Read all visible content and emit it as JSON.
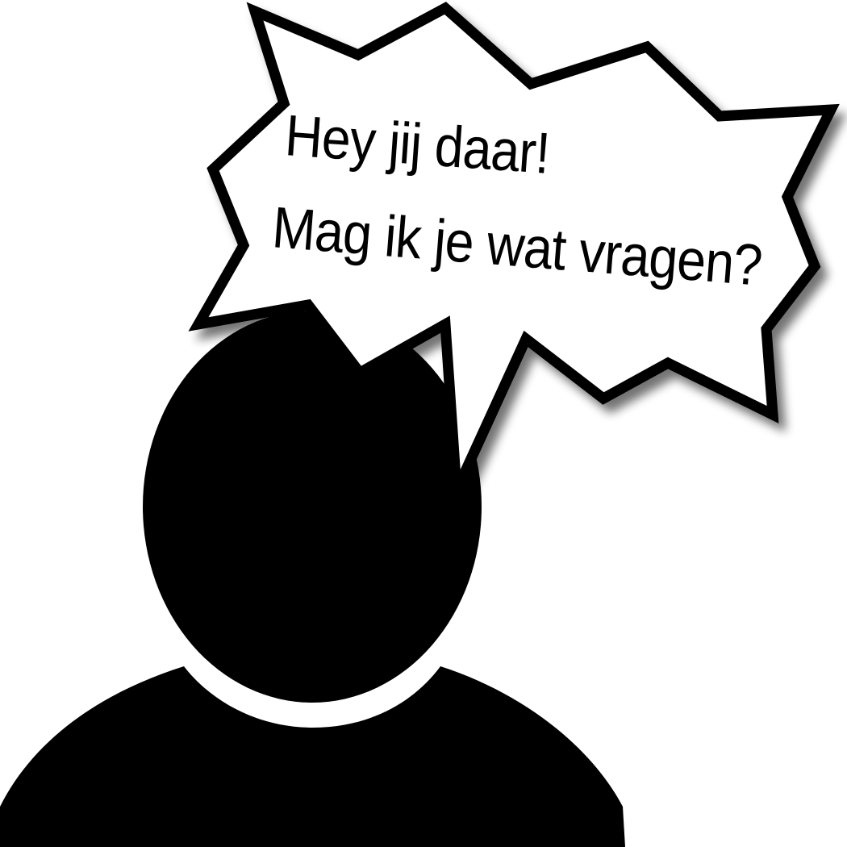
{
  "speech_bubble": {
    "line1": "Hey jij daar!",
    "line2": "Mag ik je wat vragen?"
  },
  "colors": {
    "background": "#ffffff",
    "silhouette": "#000000",
    "bubble_fill": "#ffffff",
    "bubble_stroke": "#000000",
    "shadow": "#9a9a9a"
  },
  "figure": {
    "icon": "person-silhouette-icon"
  }
}
